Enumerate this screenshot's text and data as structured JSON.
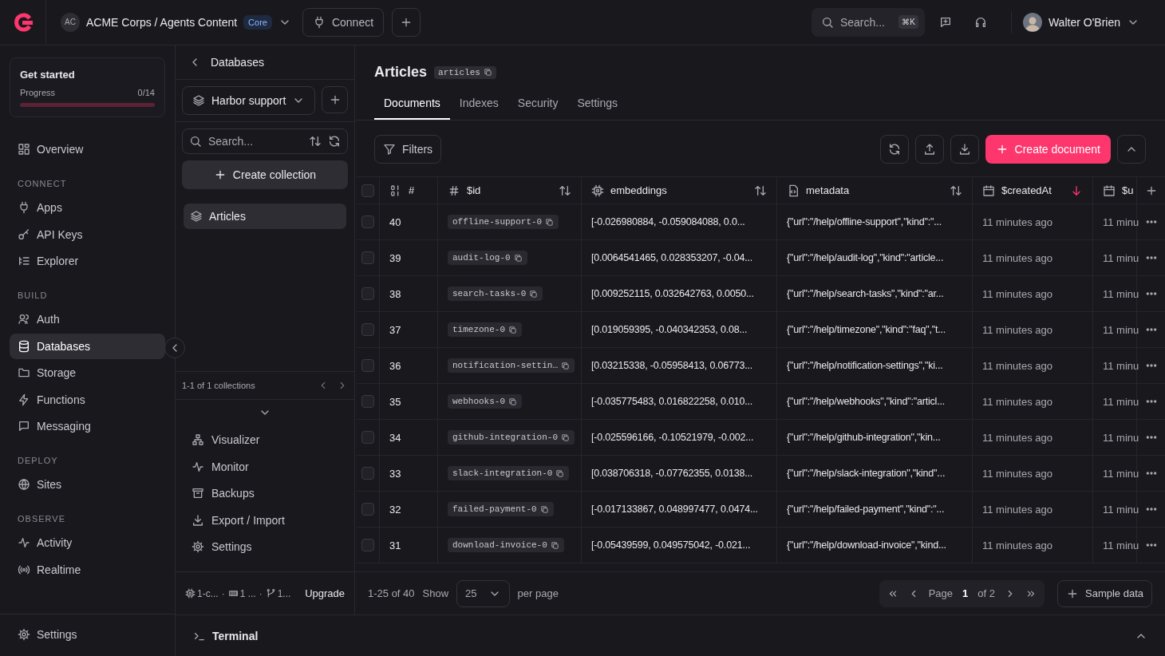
{
  "topbar": {
    "org_initials": "AC",
    "project": "ACME Corps / Agents Content",
    "plan": "Core",
    "connect": "Connect",
    "search_placeholder": "Search...",
    "shortcut": "⌘K",
    "user": "Walter O'Brien"
  },
  "sidebar": {
    "get_started": {
      "title": "Get started",
      "label": "Progress",
      "count": "0/14",
      "level": 0
    },
    "sections": [
      {
        "items": [
          {
            "label": "Overview",
            "selected": false
          }
        ]
      },
      {
        "heading": "CONNECT",
        "items": [
          {
            "label": "Apps",
            "selected": false
          },
          {
            "label": "API Keys",
            "selected": false
          },
          {
            "label": "Explorer",
            "selected": false
          }
        ]
      },
      {
        "heading": "BUILD",
        "items": [
          {
            "label": "Auth",
            "selected": false
          },
          {
            "label": "Databases",
            "selected": true
          },
          {
            "label": "Storage",
            "selected": false
          },
          {
            "label": "Functions",
            "selected": false
          },
          {
            "label": "Messaging",
            "selected": false
          }
        ]
      },
      {
        "heading": "DEPLOY",
        "items": [
          {
            "label": "Sites",
            "selected": false
          }
        ]
      },
      {
        "heading": "OBSERVE",
        "items": [
          {
            "label": "Activity",
            "selected": false
          },
          {
            "label": "Realtime",
            "selected": false
          }
        ]
      }
    ],
    "footer_item": {
      "label": "Settings",
      "selected": false
    }
  },
  "collections_panel": {
    "back": "Databases",
    "database": "Harbor support",
    "search_placeholder": "Search...",
    "create": "Create collection",
    "collections": [
      {
        "label": "Articles",
        "selected": true
      }
    ],
    "pagination": "1-1 of 1 collections",
    "tools": [
      "Visualizer",
      "Monitor",
      "Backups",
      "Export / Import",
      "Settings"
    ],
    "usage": [
      "1-c...",
      "1 ...",
      "1..."
    ],
    "separator": "·",
    "upgrade": "Upgrade"
  },
  "main": {
    "title": "Articles",
    "id_badge": "articles",
    "tabs": [
      {
        "label": "Documents",
        "selected": true
      },
      {
        "label": "Indexes",
        "selected": false
      },
      {
        "label": "Security",
        "selected": false
      },
      {
        "label": "Settings",
        "selected": false
      }
    ],
    "filters": "Filters",
    "create": "Create document",
    "table": {
      "all_checked": false,
      "columns": [
        {
          "label": "#"
        },
        {
          "label": "$id",
          "sorted": false
        },
        {
          "label": "embeddings",
          "sorted": false
        },
        {
          "label": "metadata",
          "sorted": false
        },
        {
          "label": "$createdAt",
          "sorted": true
        },
        {
          "label": "$u"
        }
      ],
      "rows": [
        {
          "checked": false,
          "cells": [
            "40",
            "offline-support-0",
            "[-0.026980884, -0.059084088, 0.0...",
            "{\"url\":\"/help/offline-support\",\"kind\":\"...",
            "11 minutes ago",
            "11 minu"
          ]
        },
        {
          "checked": false,
          "cells": [
            "39",
            "audit-log-0",
            "[0.0064541465, 0.028353207, -0.04...",
            "{\"url\":\"/help/audit-log\",\"kind\":\"article...",
            "11 minutes ago",
            "11 minu"
          ]
        },
        {
          "checked": false,
          "cells": [
            "38",
            "search-tasks-0",
            "[0.009252115, 0.032642763, 0.0050...",
            "{\"url\":\"/help/search-tasks\",\"kind\":\"ar...",
            "11 minutes ago",
            "11 minu"
          ]
        },
        {
          "checked": false,
          "cells": [
            "37",
            "timezone-0",
            "[0.019059395, -0.040342353, 0.08...",
            "{\"url\":\"/help/timezone\",\"kind\":\"faq\",\"t...",
            "11 minutes ago",
            "11 minu"
          ]
        },
        {
          "checked": false,
          "cells": [
            "36",
            "notification-settin…",
            "[0.03215338, -0.05958413, 0.06773...",
            "{\"url\":\"/help/notification-settings\",\"ki...",
            "11 minutes ago",
            "11 minu"
          ]
        },
        {
          "checked": false,
          "cells": [
            "35",
            "webhooks-0",
            "[-0.035775483, 0.016822258, 0.010...",
            "{\"url\":\"/help/webhooks\",\"kind\":\"articl...",
            "11 minutes ago",
            "11 minu"
          ]
        },
        {
          "checked": false,
          "cells": [
            "34",
            "github-integration-0",
            "[-0.025596166, -0.10521979, -0.002...",
            "{\"url\":\"/help/github-integration\",\"kin...",
            "11 minutes ago",
            "11 minu"
          ]
        },
        {
          "checked": false,
          "cells": [
            "33",
            "slack-integration-0",
            "[0.038706318, -0.07762355, 0.0138...",
            "{\"url\":\"/help/slack-integration\",\"kind\"...",
            "11 minutes ago",
            "11 minu"
          ]
        },
        {
          "checked": false,
          "cells": [
            "32",
            "failed-payment-0",
            "[-0.017133867, 0.048997477, 0.0474...",
            "{\"url\":\"/help/failed-payment\",\"kind\":\"...",
            "11 minutes ago",
            "11 minu"
          ]
        },
        {
          "checked": false,
          "cells": [
            "31",
            "download-invoice-0",
            "[-0.05439599, 0.049575042, -0.021...",
            "{\"url\":\"/help/download-invoice\",\"kind...",
            "11 minutes ago",
            "11 minu"
          ]
        }
      ]
    },
    "footer": {
      "range": "1-25 of 40",
      "show": "Show",
      "per_page": "25",
      "per_page_label": "per page",
      "page_label": "Page",
      "page": "1",
      "page_of": "of 2",
      "sample": "Sample data"
    }
  },
  "terminal": {
    "label": "Terminal"
  }
}
